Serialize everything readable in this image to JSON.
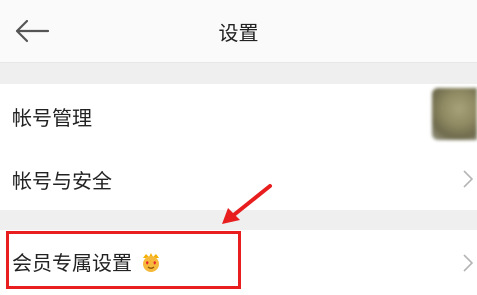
{
  "header": {
    "title": "设置",
    "back_icon": "arrow-left-icon"
  },
  "rows": [
    {
      "label": "帐号管理",
      "trailing": "avatar"
    },
    {
      "label": "帐号与安全",
      "trailing": "chevron-right-icon"
    },
    {
      "label": "会员专属设置",
      "badge": "crown-face-emoji",
      "trailing": "chevron-right-icon"
    }
  ],
  "annotation": {
    "color": "#e81d1d",
    "type": "red-box-and-arrow"
  },
  "colors": {
    "background": "#efefef",
    "row": "#ffffff",
    "accent": "#e81d1d"
  }
}
